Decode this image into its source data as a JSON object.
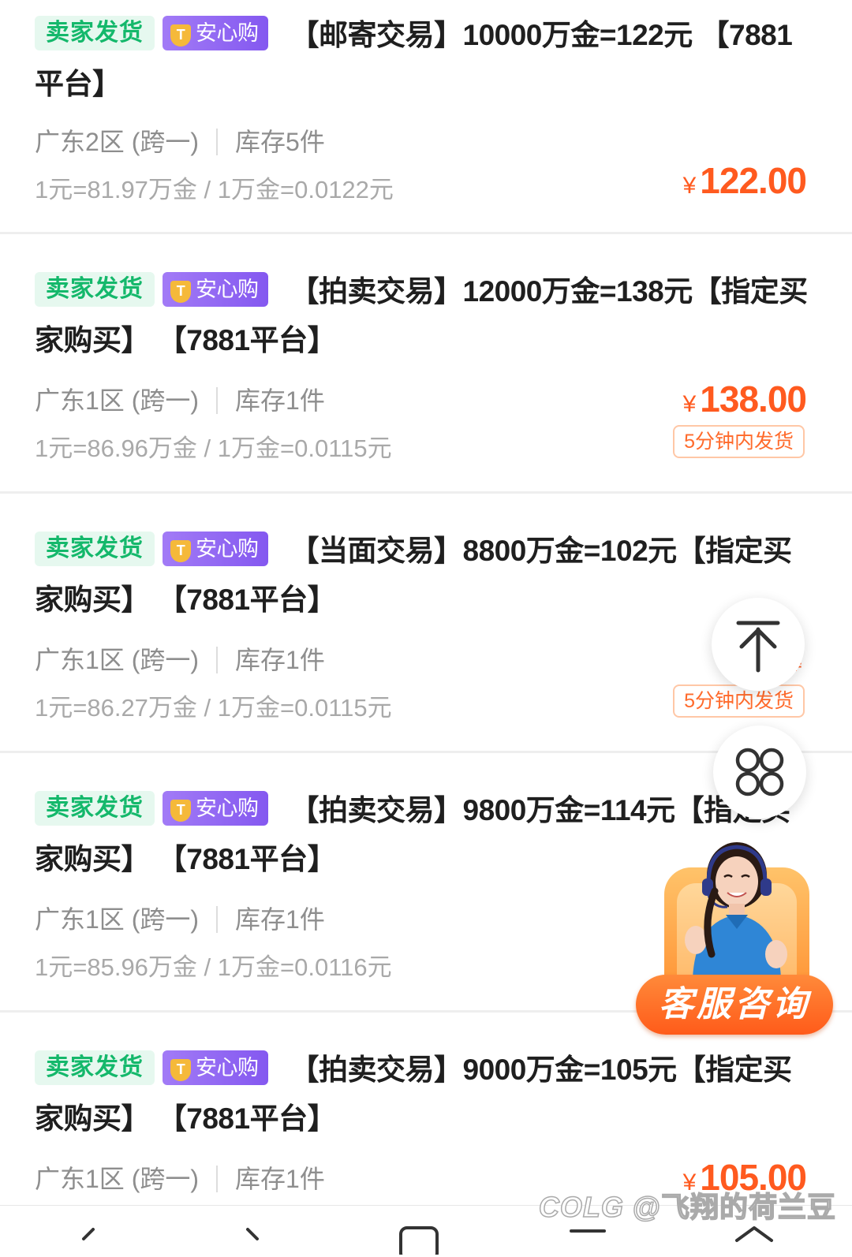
{
  "tags": {
    "seller": "卖家发货",
    "safe": "安心购",
    "safe_icon": "shield-icon"
  },
  "listings": [
    {
      "title": "【邮寄交易】10000万金=122元 【7881平台】",
      "server": "广东2区 (跨一)",
      "stock": "库存5件",
      "rate": "1元=81.97万金 / 1万金=0.0122元",
      "price": "122.00",
      "delivery": ""
    },
    {
      "title": "【拍卖交易】12000万金=138元【指定买家购买】 【7881平台】",
      "server": "广东1区 (跨一)",
      "stock": "库存1件",
      "rate": "1元=86.96万金 / 1万金=0.0115元",
      "price": "138.00",
      "delivery": "5分钟内发货"
    },
    {
      "title": "【当面交易】8800万金=102元【指定买家购买】 【7881平台】",
      "server": "广东1区 (跨一)",
      "stock": "库存1件",
      "rate": "1元=86.27万金 / 1万金=0.0115元",
      "price": "",
      "delivery": "5分钟内发货"
    },
    {
      "title": "【拍卖交易】9800万金=114元【指定买家购买】 【7881平台】",
      "server": "广东1区 (跨一)",
      "stock": "库存1件",
      "rate": "1元=85.96万金 / 1万金=0.0116元",
      "price": "",
      "delivery": ""
    },
    {
      "title": "【拍卖交易】9000万金=105元【指定买家购买】 【7881平台】",
      "server": "广东1区 (跨一)",
      "stock": "库存1件",
      "rate": "",
      "price": "105.00",
      "delivery": ""
    }
  ],
  "currency_symbol": "¥",
  "floating": {
    "back_to_top_icon": "arrow-up-to-top-icon",
    "menu_icon": "grid-menu-icon",
    "customer_service_label": "客服咨询"
  },
  "watermark": "@飞翔的荷兰豆",
  "watermark_logo": "COLG",
  "colors": {
    "accent": "#ff5a1f",
    "seller_green": "#14b86b",
    "safe_purple": "#8458f0"
  }
}
